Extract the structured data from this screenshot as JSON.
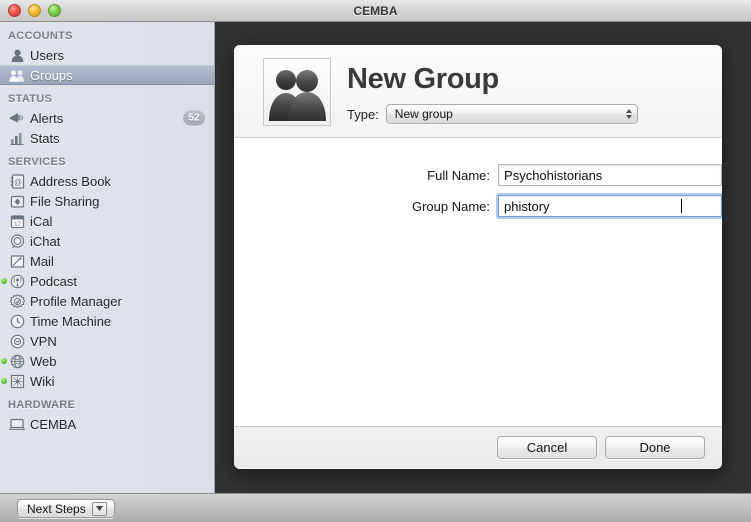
{
  "window": {
    "title": "CEMBA",
    "traffic_lights": [
      "close-button",
      "minimize-button",
      "zoom-button"
    ]
  },
  "sidebar": {
    "sections": [
      {
        "header": "ACCOUNTS",
        "items": [
          {
            "label": "Users",
            "icon": "user-icon",
            "selected": false,
            "running": false,
            "badge": ""
          },
          {
            "label": "Groups",
            "icon": "groups-icon",
            "selected": true,
            "running": false,
            "badge": ""
          }
        ]
      },
      {
        "header": "STATUS",
        "items": [
          {
            "label": "Alerts",
            "icon": "megaphone-icon",
            "selected": false,
            "running": false,
            "badge": "52"
          },
          {
            "label": "Stats",
            "icon": "bar-chart-icon",
            "selected": false,
            "running": false,
            "badge": ""
          }
        ]
      },
      {
        "header": "SERVICES",
        "items": [
          {
            "label": "Address Book",
            "icon": "address-book-icon",
            "selected": false,
            "running": false,
            "badge": ""
          },
          {
            "label": "File Sharing",
            "icon": "file-sharing-icon",
            "selected": false,
            "running": false,
            "badge": ""
          },
          {
            "label": "iCal",
            "icon": "calendar-icon",
            "selected": false,
            "running": false,
            "badge": ""
          },
          {
            "label": "iChat",
            "icon": "chat-bubble-icon",
            "selected": false,
            "running": false,
            "badge": ""
          },
          {
            "label": "Mail",
            "icon": "mail-icon",
            "selected": false,
            "running": false,
            "badge": ""
          },
          {
            "label": "Podcast",
            "icon": "podcast-icon",
            "selected": false,
            "running": true,
            "badge": ""
          },
          {
            "label": "Profile Manager",
            "icon": "gear-icon",
            "selected": false,
            "running": false,
            "badge": ""
          },
          {
            "label": "Time Machine",
            "icon": "clock-icon",
            "selected": false,
            "running": false,
            "badge": ""
          },
          {
            "label": "VPN",
            "icon": "vpn-icon",
            "selected": false,
            "running": false,
            "badge": ""
          },
          {
            "label": "Web",
            "icon": "globe-icon",
            "selected": false,
            "running": true,
            "badge": ""
          },
          {
            "label": "Wiki",
            "icon": "wiki-icon",
            "selected": false,
            "running": true,
            "badge": ""
          }
        ]
      },
      {
        "header": "HARDWARE",
        "items": [
          {
            "label": "CEMBA",
            "icon": "laptop-icon",
            "selected": false,
            "running": false,
            "badge": ""
          }
        ]
      }
    ]
  },
  "sheet": {
    "title": "New Group",
    "avatar_icon": "group-avatar-icon",
    "type": {
      "label": "Type:",
      "selected": "New group",
      "options": [
        "New group"
      ]
    },
    "fields": [
      {
        "label": "Full Name:",
        "value": "Psychohistorians",
        "placeholder": "",
        "focused": false
      },
      {
        "label": "Group Name:",
        "value": "phistory",
        "placeholder": "",
        "focused": true
      }
    ],
    "buttons": {
      "cancel": "Cancel",
      "done": "Done"
    }
  },
  "bottom_bar": {
    "next_steps": "Next Steps",
    "chevron_icon": "chevron-down-icon"
  },
  "colors": {
    "selection": "#9aa5bb",
    "focus_ring": "#6f9fd3",
    "running_dot": "#5cc12b",
    "sheet_backdrop": "#323232"
  }
}
